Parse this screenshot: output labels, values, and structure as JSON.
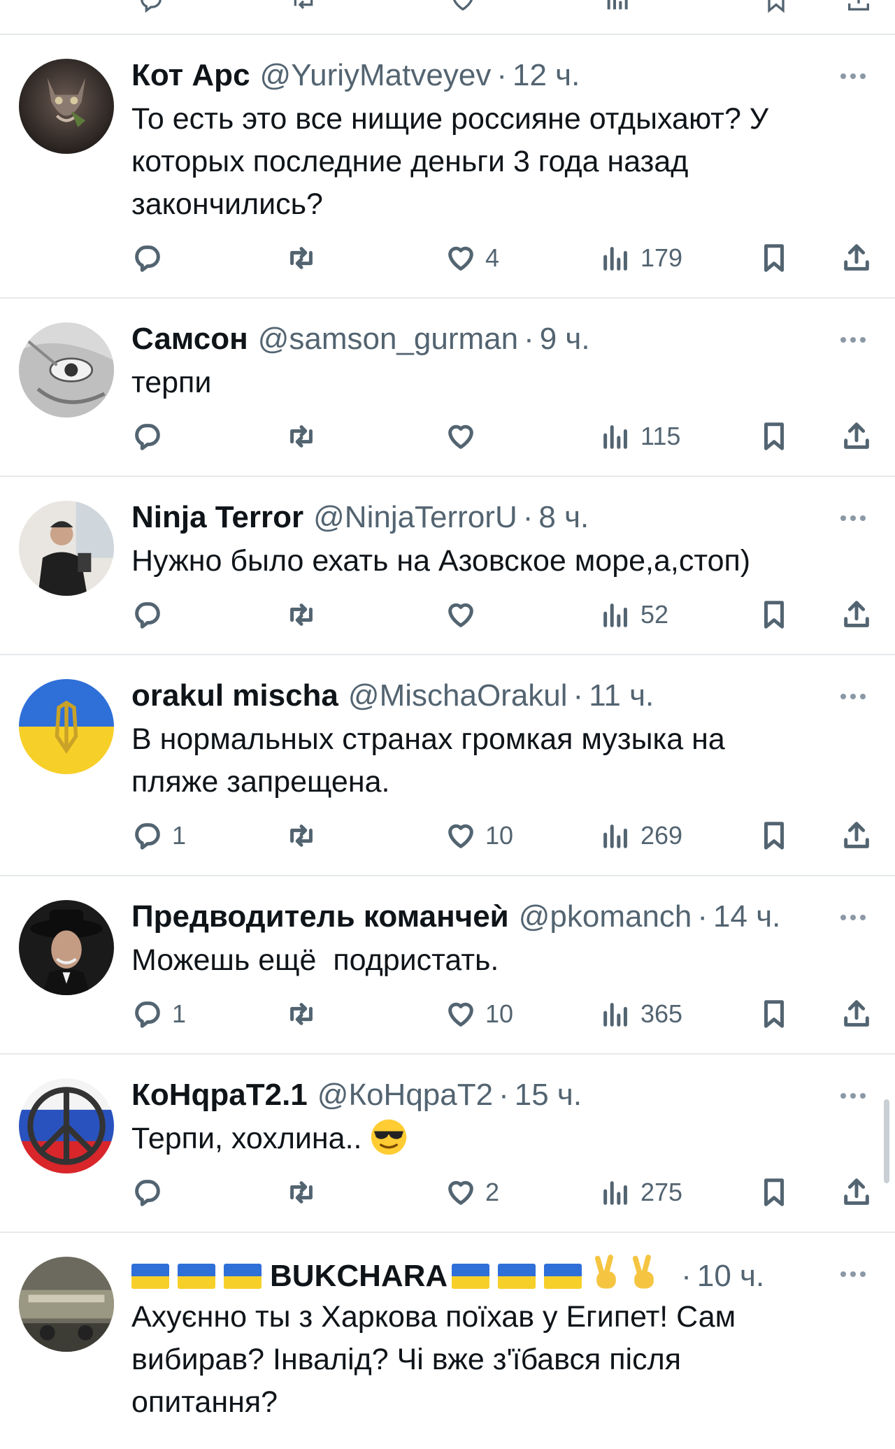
{
  "posts": [
    {
      "name": "Кот Арс",
      "handle": "@YuriyMatveyev",
      "time": "12 ч.",
      "text": "То есть это все нищие россияне отдыхают? У\nкоторых последние деньги 3 года назад\nзакончились?",
      "replies": "",
      "likes": "4",
      "views": "179"
    },
    {
      "name": "Самсон",
      "handle": "@samson_gurman",
      "time": "9 ч.",
      "text": "терпи",
      "replies": "",
      "likes": "",
      "views": "115"
    },
    {
      "name": "Ninja Terror",
      "handle": "@NinjaTerrorU",
      "time": "8 ч.",
      "text": "Нужно было ехать на Азовское море,а,стоп)",
      "replies": "",
      "likes": "",
      "views": "52"
    },
    {
      "name": "orakul mischa",
      "handle": "@MischaOrakul",
      "time": "11 ч.",
      "text": "В нормальных странах громкая музыка на\nпляже запрещена.",
      "replies": "1",
      "likes": "10",
      "views": "269"
    },
    {
      "name": "Предводитель команчеѝ",
      "handle": "@pkomanch",
      "time": "14 ч.",
      "text": "Можешь ещё  подристать.",
      "replies": "1",
      "likes": "10",
      "views": "365"
    },
    {
      "name": "КоНqраТ2.1",
      "handle": "@КоНqраТ2",
      "time": "15 ч.",
      "text": "Терпи, хохлина..",
      "replies": "",
      "likes": "2",
      "views": "275"
    },
    {
      "name": "BUKCHARA",
      "handle": "",
      "time": "10 ч.",
      "text": "Ахуєнно ты з Харкова поїхав у Египет! Сам\nвибирав? Інвалід? Чі вже з'їбався після\nопитання?",
      "replies": "",
      "likes": "",
      "views": ""
    }
  ],
  "icons": {
    "reply": "reply-icon",
    "retweet": "retweet-icon",
    "like": "heart-icon",
    "views": "views-icon",
    "bookmark": "bookmark-icon",
    "share": "share-icon",
    "more": "more-icon"
  },
  "colors": {
    "text": "#0f1419",
    "muted": "#536471",
    "divider": "#e6e9eb"
  }
}
